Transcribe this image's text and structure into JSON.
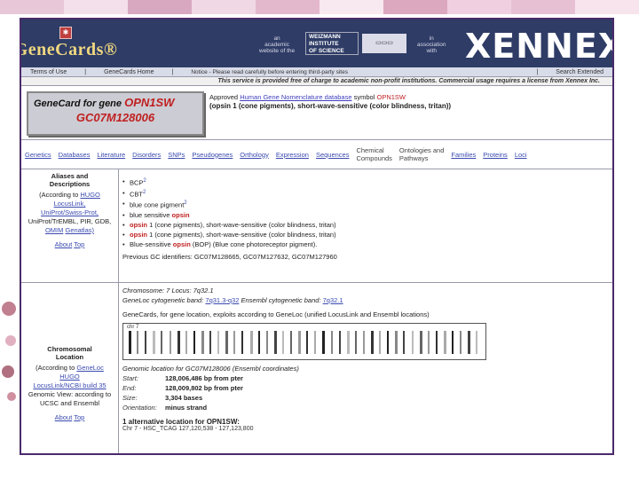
{
  "colors": {
    "header_bg": "#2e3c66",
    "logo_gold": "#f0d880",
    "accent_red": "#c02020",
    "link_blue": "#3a4ab0",
    "frame_border": "#4a2a6a"
  },
  "header": {
    "logo": "GeneCards®",
    "logo_emblem_icon": "genecards-emblem-icon",
    "left_note": "an\nacademic\nwebsite of the",
    "institute": "WEIZMANN\nINSTITUTE\nOF SCIENCE",
    "right_note": "in\nassociation\nwith",
    "partner": "XENNEX"
  },
  "navbar": {
    "terms": "Terms of Use",
    "home": "GeneCards Home",
    "notice": "Notice - Please read carefully before entering third-party sites",
    "search": "Search Extended"
  },
  "notice_bar": "This service is provided free of charge to academic non-profit institutions. Commercial usage requires a license from Xennex Inc.",
  "title": {
    "prefix": "GeneCard for gene",
    "gene": "OPN1SW",
    "id": "GC07M128006",
    "approved_prefix": "Approved",
    "approved_link": "Human Gene Nomenclature database",
    "approved_mid": "symbol",
    "approved_symbol": "OPN1SW",
    "description": "(opsin 1 (cone pigments), short-wave-sensitive (color blindness, tritan))"
  },
  "tabs": [
    {
      "label": "Genetics",
      "name": "tab-genetics"
    },
    {
      "label": "Databases",
      "name": "tab-databases"
    },
    {
      "label": "Literature",
      "name": "tab-literature"
    },
    {
      "label": "Disorders",
      "name": "tab-disorders"
    },
    {
      "label": "SNPs",
      "name": "tab-snps"
    },
    {
      "label": "Pseudogenes",
      "name": "tab-pseudogenes"
    },
    {
      "label": "Orthology",
      "name": "tab-orthology"
    },
    {
      "label": "Expression",
      "name": "tab-expression"
    },
    {
      "label": "Sequences",
      "name": "tab-sequences"
    },
    {
      "label": "Chemical\nCompounds",
      "name": "tab-chemical-compounds"
    },
    {
      "label": "Ontologies and\nPathways",
      "name": "tab-ontologies-pathways"
    },
    {
      "label": "Families",
      "name": "tab-families"
    },
    {
      "label": "Proteins",
      "name": "tab-proteins"
    },
    {
      "label": "Loci",
      "name": "tab-loci"
    }
  ],
  "aliases": {
    "heading": "Aliases and\nDescriptions",
    "sources_line1": "(According to",
    "hugo": "HUGO",
    "sources_line2": "LocusLink,",
    "swiss": "UniProt/Swiss-Prot,",
    "pir": "UniProt/TrEMBL, PIR, GDB,",
    "omim_line": "OMIM",
    "genatlas": "Genatlas)",
    "about": "About",
    "top": "Top",
    "items": [
      {
        "text": "BCP",
        "sup": "2"
      },
      {
        "text": "CBT",
        "sup": "2"
      },
      {
        "text": "blue cone pigment",
        "sup": "2"
      },
      {
        "pre": "blue sensitive ",
        "red": "opsin",
        "text": ""
      },
      {
        "pre": "",
        "red": "opsin",
        "text": " 1 (cone pigments), short-wave-sensitive (color blindness, tritan)"
      },
      {
        "pre": "",
        "red": "opsin",
        "text": " 1 (cone pigments), short-wave-sensitive (color blindness, tritan)"
      },
      {
        "pre": "Blue-sensitive ",
        "red": "opsin",
        "text": " (BOP) (Blue cone photoreceptor pigment)."
      }
    ],
    "previous_ids": "Previous GC identifiers: GC07M128665, GC07M127632, GC07M127960"
  },
  "chromosome": {
    "heading": "Chromosomal\nLocation",
    "sources": "(According to",
    "genecards": "GeneLoc",
    "hugo": "HUGO",
    "locuslink": "LocusLink/NCBI build 35",
    "genome": "Genomic View: according to UCSC and Ensembl",
    "about": "About",
    "top": "Top",
    "chrom_label": "Chromosome: 7",
    "gene_band_label": "Locus: 7q32.1",
    "ensembl_band_label": "Ensembl cytogenetic band:",
    "ensembl_band": "7q32.1",
    "genecards_band_label": "GeneLoc cytogenetic band:",
    "genecards_band": "7q31.3-q32",
    "note": "GeneCards, for gene location, exploits according to GeneLoc (unified LocusLink and Ensembl locations)",
    "chr": "chr 7",
    "genomic_title": "Genomic location for GC07M128006 (Ensembl coordinates)",
    "start_label": "Start:",
    "start": "128,006,486 bp from pter",
    "end_label": "End:",
    "end": "128,009,802 bp from pter",
    "size_label": "Size:",
    "size": "3,304 bases",
    "orientation_label": "Orientation:",
    "orientation": "minus strand",
    "alt": "1 alternative location for OPN1SW:",
    "alt_detail": "Chr 7 - HSC_TCAG 127,120,538 - 127,123,800"
  }
}
